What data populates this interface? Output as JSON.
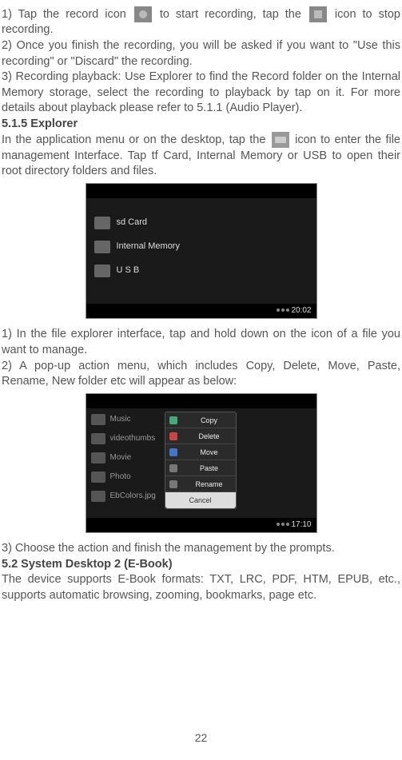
{
  "p1a": "1) Tap the record icon",
  "p1b": "to start recording, tap the",
  "p1c": "icon to stop recording.",
  "p2": "2) Once you finish the recording, you will be asked if you want to \"Use this recording\" or \"Discard\" the recording.",
  "p3": "3) Recording playback: Use Explorer to find the Record folder on the Internal Memory storage, select the recording to playback by tap on it. For more details about playback please refer to 5.1.1 (Audio Player).",
  "h515": "5.1.5 Explorer",
  "p4a": "In the application menu or on the desktop, tap the",
  "p4b": "icon to enter the file management Interface. Tap tf Card, Internal Memory or USB to open their root directory folders and files.",
  "fig1": {
    "row1": "sd Card",
    "row2": "Internal Memory",
    "row3": "U S B",
    "time": "20:02"
  },
  "p5": "1) In the file explorer interface, tap and hold down on the icon of a file you want to manage.",
  "p6": "2) A pop-up action menu, which includes Copy, Delete, Move, Paste, Rename, New folder etc will appear as below:",
  "fig2": {
    "rows": [
      "Music",
      "videothumbs",
      "Movie",
      "Photo",
      "EbColors.jpg"
    ],
    "menu": [
      "Copy",
      "Delete",
      "Move",
      "Paste",
      "Rename"
    ],
    "cancel": "Cancel",
    "time": "17:10"
  },
  "p7": "3) Choose the action and finish the management by the prompts.",
  "h52": "5.2 System Desktop 2 (E-Book)",
  "p8": "The device supports E-Book formats: TXT, LRC, PDF, HTM, EPUB, etc., supports automatic browsing, zooming, bookmarks, page etc.",
  "pagenum": "22"
}
